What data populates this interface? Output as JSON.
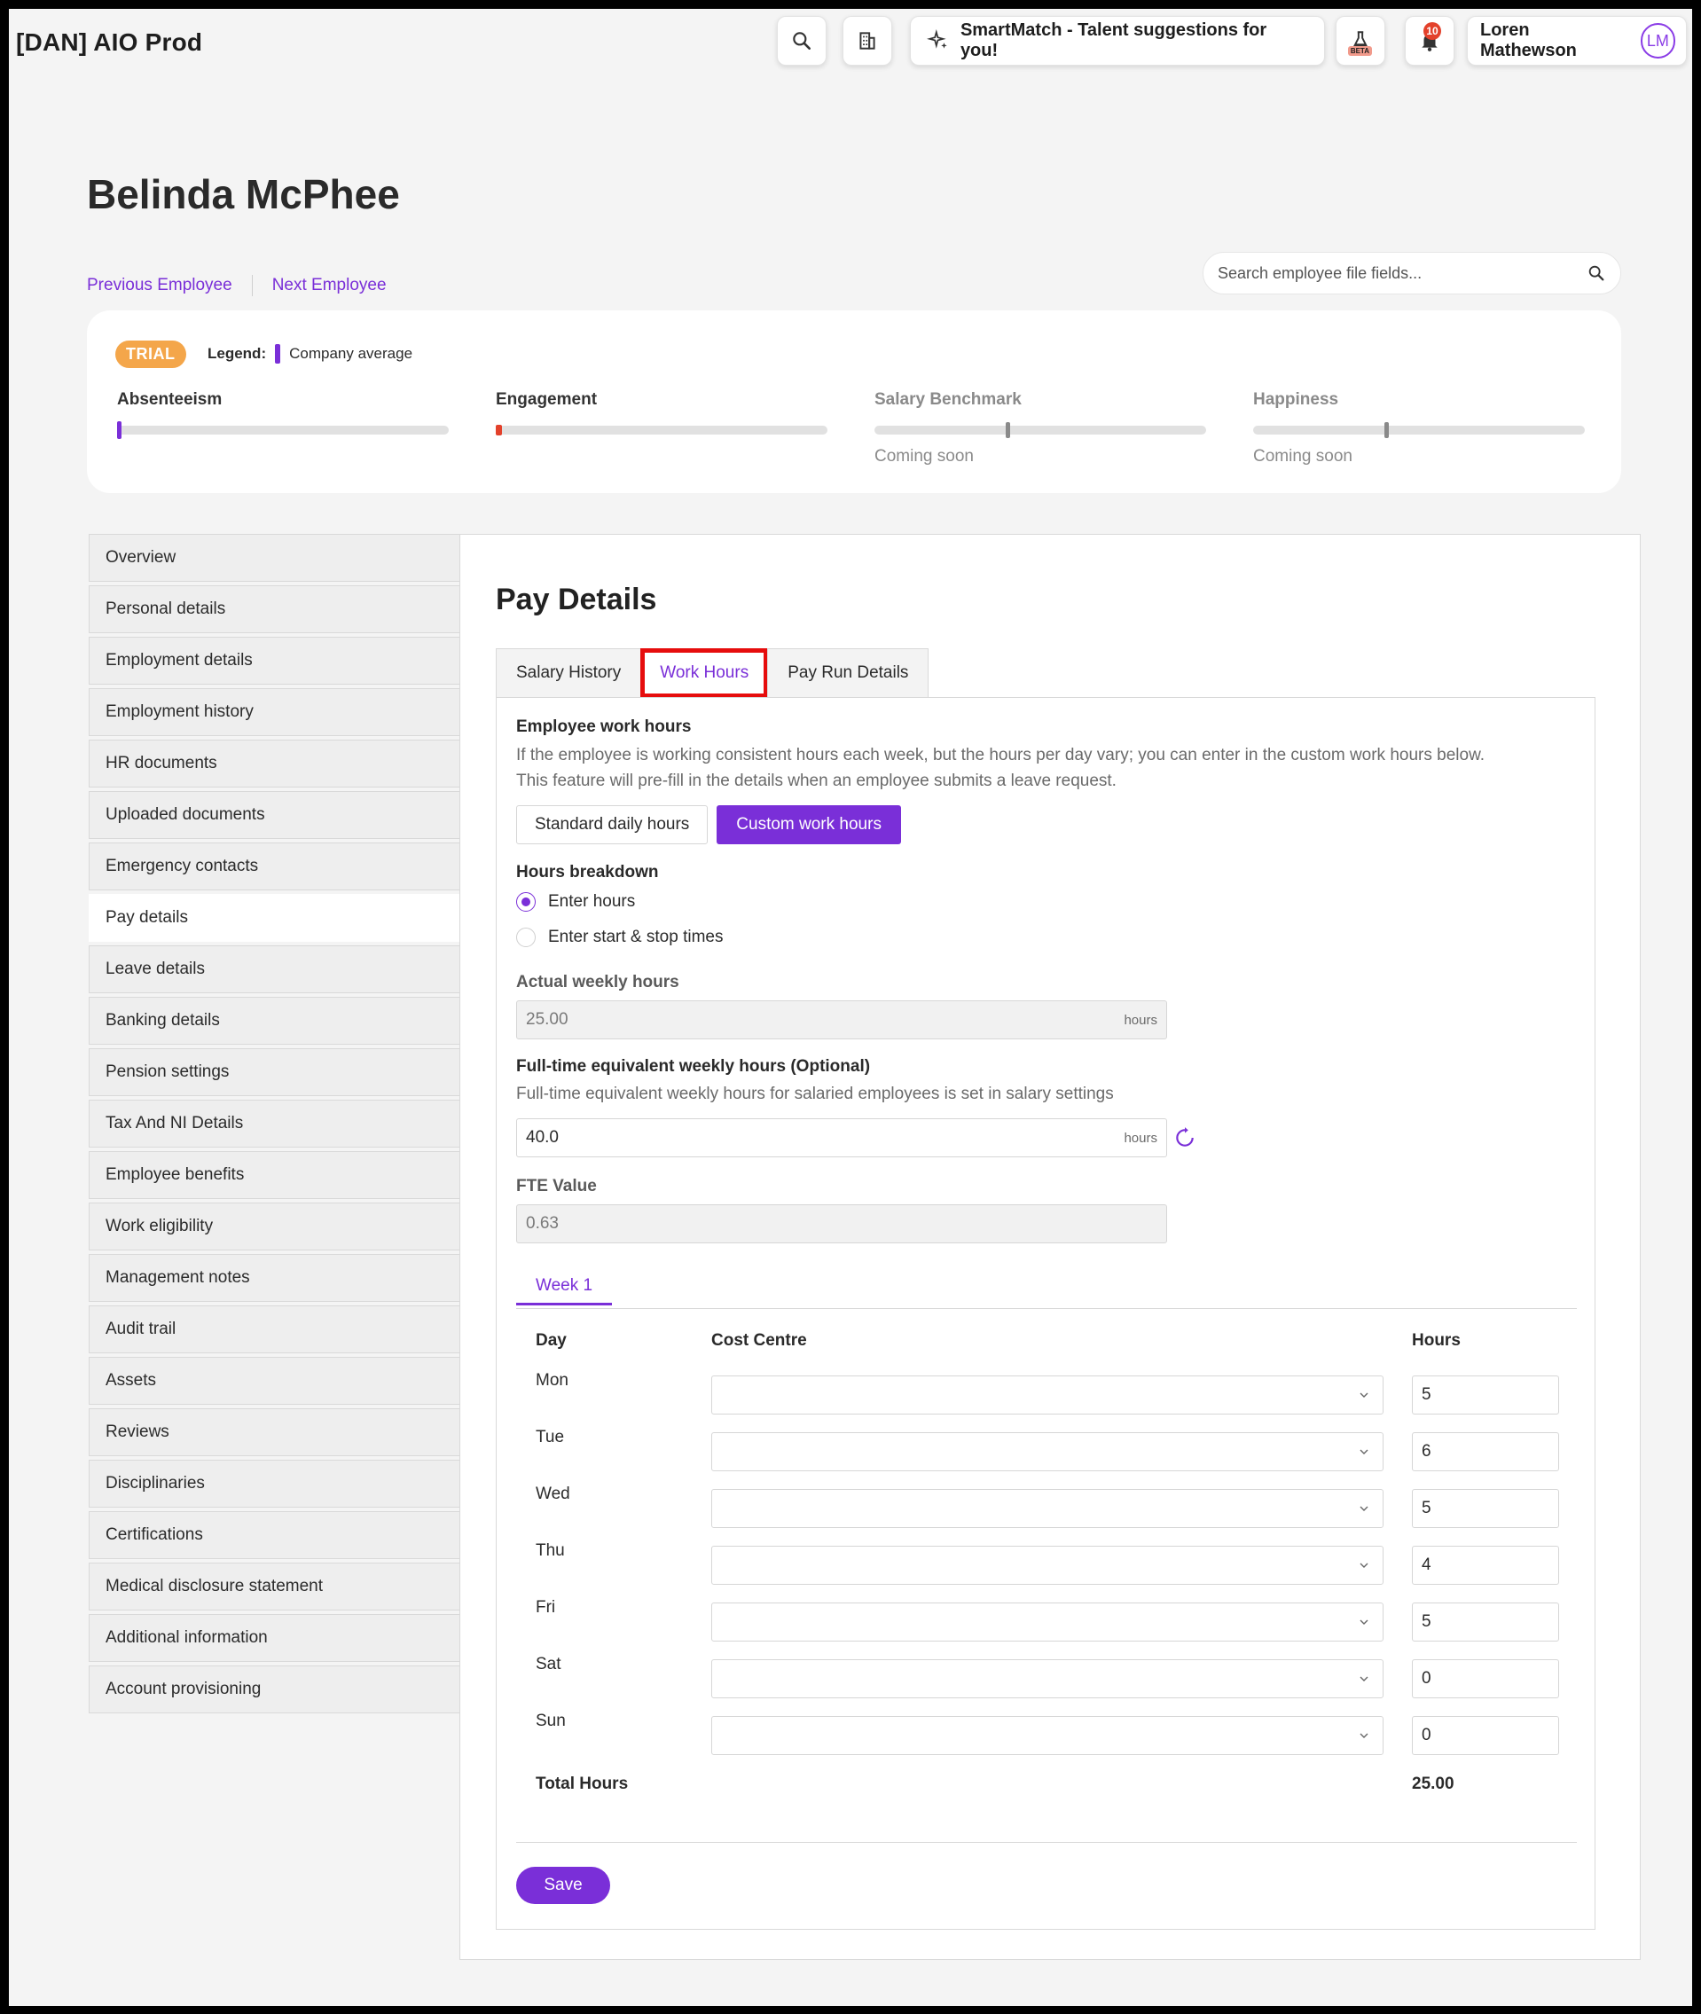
{
  "topbar": {
    "brand": "[DAN] AIO Prod",
    "smartmatch_label": "SmartMatch - Talent suggestions for you!",
    "beta_label": "BETA",
    "notification_count": "10",
    "user_name": "Loren Mathewson",
    "user_initials": "LM"
  },
  "employee": {
    "name": "Belinda McPhee",
    "prev_label": "Previous Employee",
    "next_label": "Next Employee"
  },
  "file_search": {
    "placeholder": "Search employee file fields..."
  },
  "stats": {
    "badge": "TRIAL",
    "legend_label": "Legend:",
    "legend_item": "Company average",
    "metrics": [
      {
        "label": "Absenteeism",
        "status": ""
      },
      {
        "label": "Engagement",
        "status": ""
      },
      {
        "label": "Salary Benchmark",
        "status": "Coming soon"
      },
      {
        "label": "Happiness",
        "status": "Coming soon"
      }
    ]
  },
  "sidebar": {
    "items": [
      {
        "label": "Overview"
      },
      {
        "label": "Personal details"
      },
      {
        "label": "Employment details"
      },
      {
        "label": "Employment history"
      },
      {
        "label": "HR documents"
      },
      {
        "label": "Uploaded documents"
      },
      {
        "label": "Emergency contacts"
      },
      {
        "label": "Pay details",
        "active": true
      },
      {
        "label": "Leave details"
      },
      {
        "label": "Banking details"
      },
      {
        "label": "Pension settings"
      },
      {
        "label": "Tax And NI Details"
      },
      {
        "label": "Employee benefits"
      },
      {
        "label": "Work eligibility"
      },
      {
        "label": "Management notes"
      },
      {
        "label": "Audit trail"
      },
      {
        "label": "Assets"
      },
      {
        "label": "Reviews"
      },
      {
        "label": "Disciplinaries"
      },
      {
        "label": "Certifications"
      },
      {
        "label": "Medical disclosure statement"
      },
      {
        "label": "Additional information"
      },
      {
        "label": "Account provisioning"
      }
    ]
  },
  "main": {
    "title": "Pay Details",
    "tabs": [
      {
        "label": "Salary History"
      },
      {
        "label": "Work Hours",
        "active": true
      },
      {
        "label": "Pay Run Details"
      }
    ],
    "work_hours": {
      "section_title": "Employee work hours",
      "description_line1": "If the employee is working consistent hours each week, but the hours per day vary; you can enter in the custom work hours below.",
      "description_line2": "This feature will pre-fill in the details when an employee submits a leave request.",
      "standard_label": "Standard daily hours",
      "custom_label": "Custom work hours",
      "breakdown_title": "Hours breakdown",
      "radio_enter_hours": "Enter hours",
      "radio_start_stop": "Enter start & stop times",
      "actual_weekly_label": "Actual weekly hours",
      "actual_weekly_value": "25.00",
      "unit": "hours",
      "fte_weekly_label": "Full-time equivalent weekly hours (Optional)",
      "fte_weekly_help": "Full-time equivalent weekly hours for salaried employees is set in salary settings",
      "fte_weekly_value": "40.0",
      "fte_value_label": "FTE Value",
      "fte_value": "0.63",
      "week_tab": "Week 1",
      "col_day": "Day",
      "col_cost_centre": "Cost Centre",
      "col_hours": "Hours",
      "days": [
        {
          "day": "Mon",
          "hours": "5"
        },
        {
          "day": "Tue",
          "hours": "6"
        },
        {
          "day": "Wed",
          "hours": "5"
        },
        {
          "day": "Thu",
          "hours": "4"
        },
        {
          "day": "Fri",
          "hours": "5"
        },
        {
          "day": "Sat",
          "hours": "0"
        },
        {
          "day": "Sun",
          "hours": "0"
        }
      ],
      "total_label": "Total Hours",
      "total_value": "25.00",
      "save_label": "Save"
    }
  },
  "colors": {
    "accent": "#7a2fd8",
    "highlight_box": "#e60d0d",
    "trial": "#f4a64a"
  }
}
